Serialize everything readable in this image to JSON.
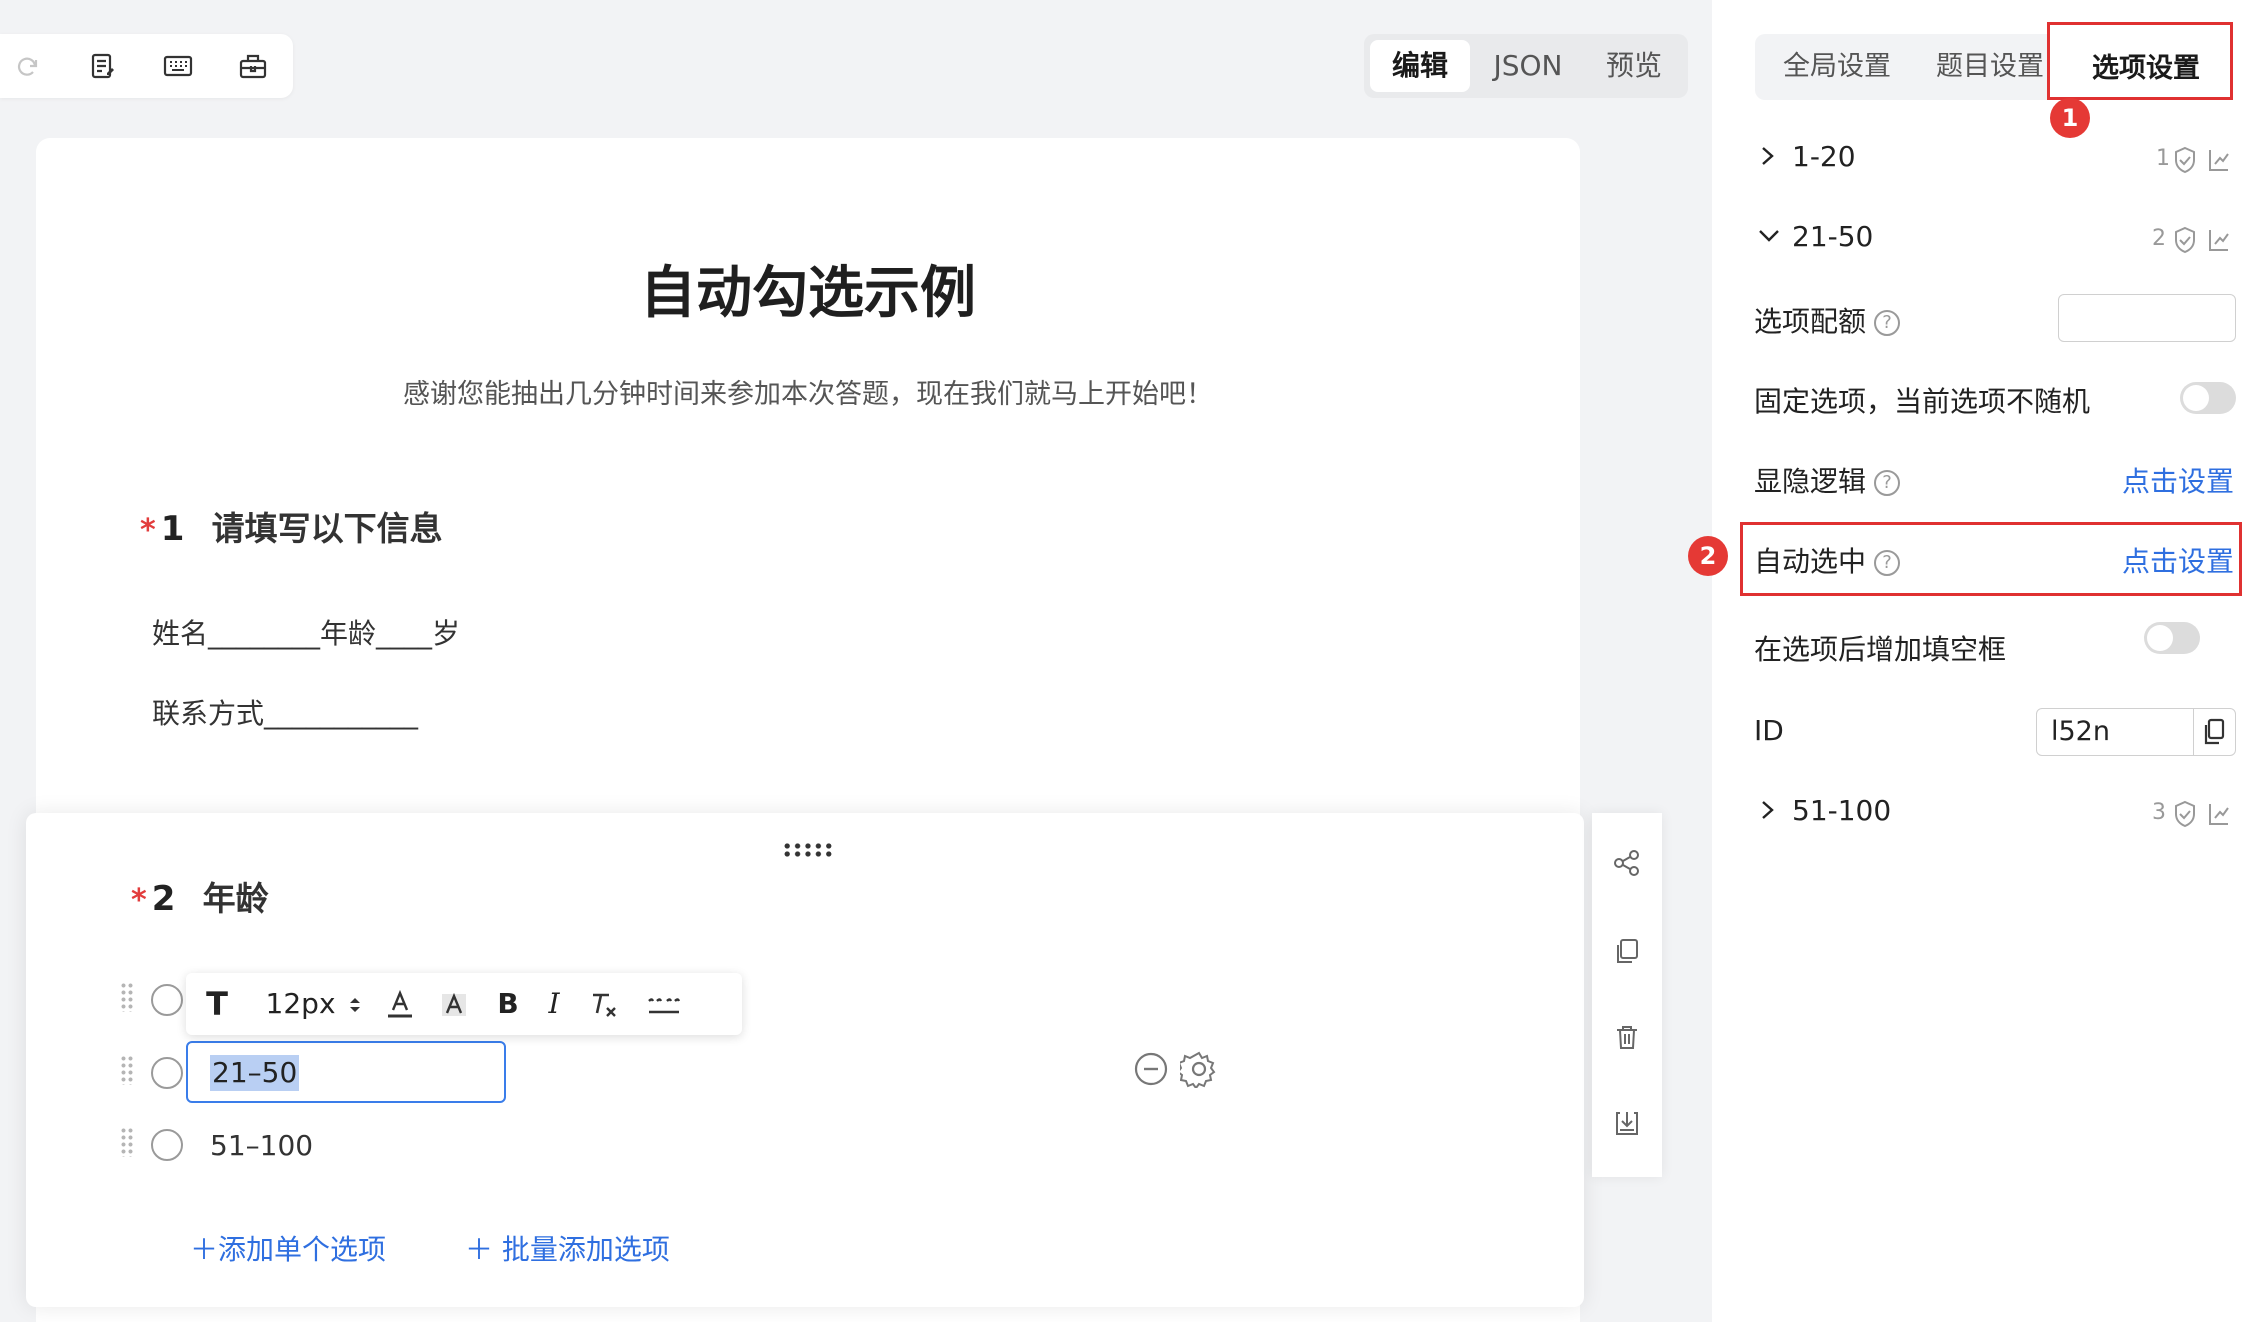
{
  "toolbar": {
    "icons": [
      "redo-icon",
      "form-edit-icon",
      "keyboard-icon",
      "toolbox-icon"
    ]
  },
  "view_tabs": [
    {
      "label": "编辑",
      "active": true
    },
    {
      "label": "JSON",
      "active": false
    },
    {
      "label": "预览",
      "active": false
    }
  ],
  "survey": {
    "title": "自动勾选示例",
    "intro": "感谢您能抽出几分钟时间来参加本次答题，现在我们就马上开始吧！",
    "q1": {
      "required_mark": "*",
      "number": "1",
      "title": "请填写以下信息",
      "line1": "姓名________年龄____岁",
      "line2": "联系方式___________"
    },
    "q2": {
      "required_mark": "*",
      "number": "2",
      "title": "年龄",
      "options": [
        "1-20",
        "21-50",
        "51-100"
      ],
      "editing_value": "21–50",
      "option3_label": "51–100",
      "add_single": "＋添加单个选项",
      "add_batch": "＋ 批量添加选项"
    }
  },
  "rich_toolbar": {
    "text_icon": "T",
    "font_size": "12px",
    "bold": "B",
    "italic": "I",
    "icons": [
      "font-color-icon",
      "font-highlight-icon",
      "clear-format-icon",
      "blank-insert-icon"
    ]
  },
  "side_tools": [
    "logic-icon",
    "copy-icon",
    "delete-icon",
    "save-icon"
  ],
  "settings_panel": {
    "tabs": [
      {
        "label": "全局设置",
        "active": false
      },
      {
        "label": "题目设置",
        "active": false
      },
      {
        "label": "选项设置",
        "active": true
      }
    ],
    "badge1": "1",
    "badge2": "2",
    "groups": [
      {
        "label": "1-20",
        "count": "1",
        "expanded": false
      },
      {
        "label": "21-50",
        "count": "2",
        "expanded": true
      },
      {
        "label": "51-100",
        "count": "3",
        "expanded": false
      }
    ],
    "quota_label": "选项配额",
    "fixed_label": "固定选项，当前选项不随机",
    "visibility_label": "显隐逻辑",
    "visibility_link": "点击设置",
    "auto_select_label": "自动选中",
    "auto_select_link": "点击设置",
    "fill_blank_label": "在选项后增加填空框",
    "id_label": "ID",
    "id_value": "l52n",
    "help_mark": "?"
  },
  "colors": {
    "accent": "#2f6fe0",
    "highlight_box": "#e03131",
    "required": "#e23c3c"
  }
}
